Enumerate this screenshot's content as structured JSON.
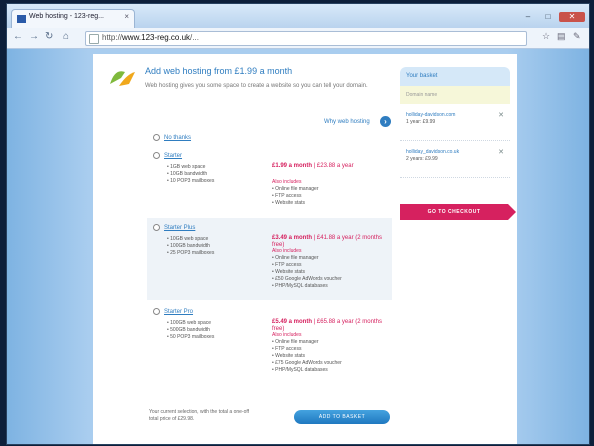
{
  "browser": {
    "tab_title": "Web hosting - 123-reg...",
    "url_prefix": "http://",
    "url_domain": "www.123-reg.co.uk",
    "url_path": "/...",
    "icons": {
      "back": "back-arrow-icon",
      "forward": "forward-arrow-icon",
      "reload": "reload-icon",
      "home": "home-icon",
      "star": "star-icon",
      "page": "page-icon",
      "wrench": "wrench-icon"
    }
  },
  "page": {
    "headline": "Add web hosting from £1.99 a month",
    "intro": "Web hosting gives you some space to create a website so you can tell your domain.",
    "more_link": "Why web hosting",
    "plans_radio_none": "No thanks",
    "plans": [
      {
        "name": "Starter",
        "features": [
          "1GB web space",
          "10GB bandwidth",
          "10 POP3 mailboxes"
        ],
        "price": "£1.99 a month",
        "price_note": " | £23.88 a year",
        "also_heading": "Also includes",
        "also": [
          "Online file manager",
          "FTP access",
          "Website stats"
        ]
      },
      {
        "name": "Starter Plus",
        "features": [
          "10GB web space",
          "100GB bandwidth",
          "25 POP3 mailboxes"
        ],
        "price": "£3.49 a month",
        "price_note": " | £41.88 a year (2 months free)",
        "also_heading": "Also includes",
        "also": [
          "Online file manager",
          "FTP access",
          "Website stats",
          "£50 Google AdWords voucher",
          "PHP/MySQL databases"
        ]
      },
      {
        "name": "Starter Pro",
        "features": [
          "100GB web space",
          "500GB bandwidth",
          "50 POP3 mailboxes"
        ],
        "price": "£5.49 a month",
        "price_note": " | £65.88 a year (2 months free)",
        "also_heading": "Also includes",
        "also": [
          "Online file manager",
          "FTP access",
          "Website stats",
          "£75 Google AdWords voucher",
          "PHP/MySQL databases"
        ]
      }
    ],
    "summary": "Your current selection, with the total a one-off total price of £29.98.",
    "add_basket": "ADD TO BASKET"
  },
  "sidebar": {
    "header": "Your basket",
    "note": "Domain name",
    "items": [
      {
        "name": "holliday-davidson.com",
        "detail": "1 year: £9.99"
      },
      {
        "name": "holliday_davidson.co.uk",
        "detail": "2 years: £9.99"
      }
    ],
    "checkout": "GO TO CHECKOUT"
  }
}
